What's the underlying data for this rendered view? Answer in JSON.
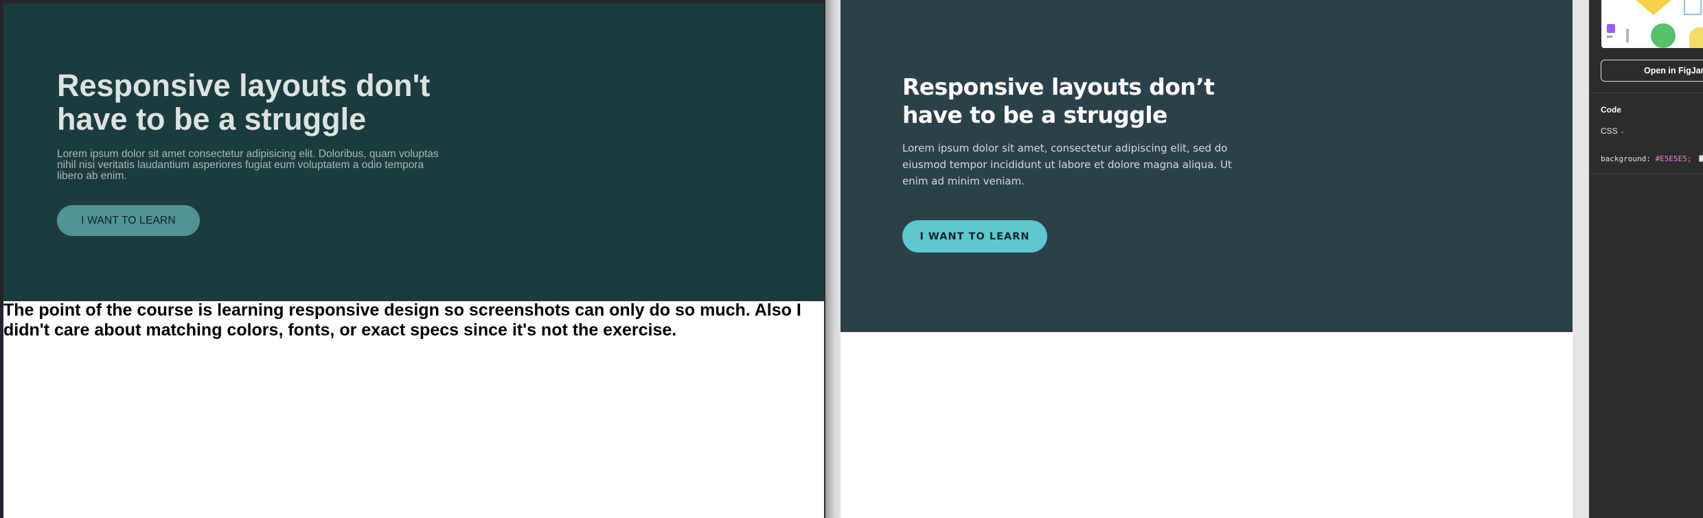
{
  "left_preview": {
    "heading": "Responsive layouts don't have to be a struggle",
    "paragraph": "Lorem ipsum dolor sit amet consectetur adipisicing elit. Doloribus, quam voluptas nihil nisi veritatis laudantium asperiores fugiat eum voluptatem a odio tempora libero ab enim.",
    "button_label": "I WANT TO LEARN",
    "note": "The point of the course is learning responsive design so screenshots can only do so much. Also I didn't care about matching colors, fonts, or exact specs since it's not the exercise."
  },
  "design_frame": {
    "heading": "Responsive layouts don’t have to be a struggle",
    "paragraph": "Lorem ipsum dolor sit amet, consectetur adipiscing elit, sed do eiusmod tempor incididunt ut labore et dolore magna aliqua. Ut enim ad minim veniam.",
    "button_label": "I WANT TO LEARN"
  },
  "inspector": {
    "open_figjam_label": "Open in FigJam",
    "code_section_label": "Code",
    "language_select_value": "CSS",
    "code_property": "background:",
    "code_value": "#E5E5E5;"
  },
  "colors": {
    "left_hero_bg": "#1c3b3c",
    "left_button_bg": "#4f9493",
    "design_hero_bg": "#2c4049",
    "design_button_bg": "#5fc7d0",
    "inspector_bg": "#2c2c2c",
    "canvas_bg": "#E5E5E5"
  }
}
